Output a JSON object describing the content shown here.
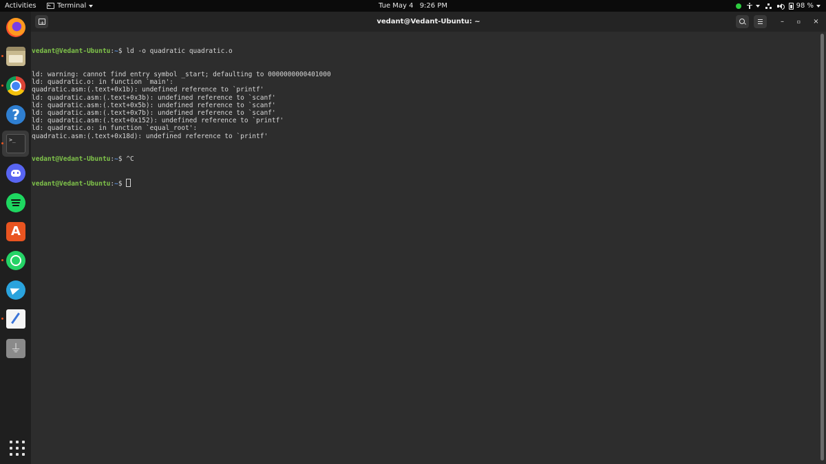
{
  "topbar": {
    "activities": "Activities",
    "app_name": "Terminal",
    "date": "Tue May 4",
    "time": "9:26 PM",
    "battery": "98 %"
  },
  "dock": {
    "items": [
      {
        "name": "firefox",
        "running": false,
        "active": false
      },
      {
        "name": "files",
        "running": true,
        "active": false
      },
      {
        "name": "chrome",
        "running": true,
        "active": false
      },
      {
        "name": "help",
        "running": false,
        "active": false
      },
      {
        "name": "terminal",
        "running": true,
        "active": true
      },
      {
        "name": "discord",
        "running": false,
        "active": false
      },
      {
        "name": "spotify",
        "running": false,
        "active": false
      },
      {
        "name": "software-store",
        "running": false,
        "active": false
      },
      {
        "name": "whatsapp",
        "running": true,
        "active": false
      },
      {
        "name": "telegram",
        "running": false,
        "active": false
      },
      {
        "name": "text-editor",
        "running": true,
        "active": false
      },
      {
        "name": "usb-drive",
        "running": false,
        "active": false
      }
    ],
    "terminal_icon_text": ">_",
    "help_icon_text": "?",
    "store_icon_text": "A",
    "usb_icon_text": "⏚"
  },
  "window": {
    "title": "vedant@Vedant-Ubuntu: ~"
  },
  "terminal": {
    "prompt_user": "vedant@Vedant-Ubuntu",
    "prompt_sep": ":",
    "prompt_path": "~",
    "prompt_symbol": "$ ",
    "command_1": "ld -o quadratic quadratic.o",
    "output": [
      "ld: warning: cannot find entry symbol _start; defaulting to 0000000000401000",
      "ld: quadratic.o: in function `main':",
      "quadratic.asm:(.text+0x1b): undefined reference to `printf'",
      "ld: quadratic.asm:(.text+0x3b): undefined reference to `scanf'",
      "ld: quadratic.asm:(.text+0x5b): undefined reference to `scanf'",
      "ld: quadratic.asm:(.text+0x7b): undefined reference to `scanf'",
      "ld: quadratic.asm:(.text+0x152): undefined reference to `printf'",
      "ld: quadratic.o: in function `equal_root':",
      "quadratic.asm:(.text+0x18d): undefined reference to `printf'"
    ],
    "command_2": "^C",
    "command_3": ""
  },
  "colors": {
    "prompt_user": "#7fc34a",
    "prompt_path": "#5c8fd6",
    "running_dot": "#e95420",
    "terminal_bg": "#2d2d2d",
    "topbar_bg": "#0b0b0b"
  }
}
